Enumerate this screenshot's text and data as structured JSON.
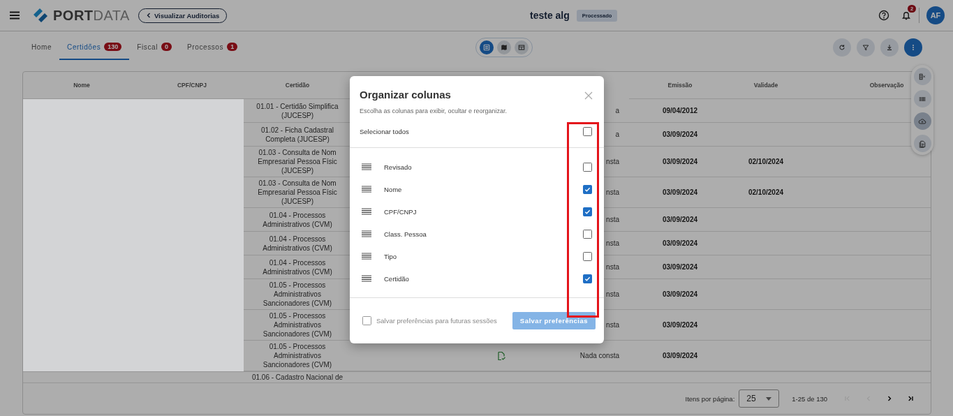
{
  "header": {
    "logo": {
      "primary": "PORT",
      "secondary": "DATA"
    },
    "back_button": "Visualizar Auditorias",
    "title": "teste alg",
    "status_chip": "Processado",
    "notification_count": "2",
    "avatar": "AF"
  },
  "tabs": [
    {
      "label": "Home",
      "selected": false
    },
    {
      "label": "Certidões",
      "count": "130",
      "selected": true
    },
    {
      "label": "Fiscal",
      "count": "0",
      "selected": false
    },
    {
      "label": "Processos",
      "count": "1",
      "selected": false
    }
  ],
  "view_toggles": [
    {
      "kind": "list",
      "selected": true
    },
    {
      "kind": "map",
      "selected": false
    },
    {
      "kind": "grid",
      "selected": false
    }
  ],
  "toolbar_actions": [
    {
      "kind": "refresh"
    },
    {
      "kind": "filter"
    },
    {
      "kind": "download"
    },
    {
      "kind": "more"
    }
  ],
  "side_actions": [
    {
      "kind": "columns",
      "highlighted": false
    },
    {
      "kind": "barcode",
      "highlighted": false
    },
    {
      "kind": "upload",
      "highlighted": true
    },
    {
      "kind": "document",
      "highlighted": false
    }
  ],
  "table": {
    "columns": [
      "Nome",
      "CPF/CNPJ",
      "Certidão",
      "Emissão",
      "Validade",
      "Observação"
    ],
    "rows": [
      {
        "certidao": "01.01 - Certidão Simplifica (JUCESP)",
        "status": "a",
        "emissao": "09/04/2012"
      },
      {
        "certidao": "01.02 - Ficha Cadastral Completa (JUCESP)",
        "status": "a",
        "emissao": "03/09/2024"
      },
      {
        "certidao": "01.03 - Consulta de Nom Empresarial Pessoa Físic (JUCESP)",
        "status": "nsta",
        "emissao": "03/09/2024",
        "validade": "02/10/2024"
      },
      {
        "certidao": "01.03 - Consulta de Nom Empresarial Pessoa Físic (JUCESP)",
        "status": "nsta",
        "emissao": "03/09/2024",
        "validade": "02/10/2024"
      },
      {
        "certidao": "01.04 - Processos Administrativos (CVM)",
        "status": "nsta",
        "emissao": "03/09/2024"
      },
      {
        "certidao": "01.04 - Processos Administrativos (CVM)",
        "status": "nsta",
        "emissao": "03/09/2024"
      },
      {
        "certidao": "01.04 - Processos Administrativos (CVM)",
        "status": "nsta",
        "emissao": "03/09/2024"
      },
      {
        "certidao": "01.05 - Processos Administrativos Sancionadores (CVM)",
        "status": "nsta",
        "emissao": "03/09/2024"
      },
      {
        "certidao": "01.05 - Processos Administrativos Sancionadores (CVM)",
        "status": "nsta",
        "emissao": "03/09/2024"
      },
      {
        "certidao": "01.05 - Processos Administrativos Sancionadores (CVM)",
        "status": "Nada consta",
        "emissao": "03/09/2024",
        "file_icon": true
      },
      {
        "certidao": "01.06 - Cadastro Nacional de"
      }
    ]
  },
  "pagination": {
    "label": "Itens por página:",
    "page_size": "25",
    "range": "1-25 de 130",
    "nav": [
      {
        "kind": "first",
        "disabled": true
      },
      {
        "kind": "prev",
        "disabled": true
      },
      {
        "kind": "next",
        "disabled": false
      },
      {
        "kind": "last",
        "disabled": false
      }
    ]
  },
  "modal": {
    "title": "Organizar colunas",
    "subtitle": "Escolha as colunas para exibir, ocultar e reorganizar.",
    "select_all": {
      "label": "Selecionar todos",
      "checked": false
    },
    "columns": [
      {
        "label": "Revisado",
        "checked": false
      },
      {
        "label": "Nome",
        "checked": true
      },
      {
        "label": "CPF/CNPJ",
        "checked": true
      },
      {
        "label": "Class. Pessoa",
        "checked": false
      },
      {
        "label": "Tipo",
        "checked": false
      },
      {
        "label": "Certidão",
        "checked": true
      }
    ],
    "save_prefs": {
      "label": "Salvar preferências para futuras sessões",
      "checked": false
    },
    "save_button": {
      "label": "Salvar preferências",
      "disabled": true
    }
  }
}
